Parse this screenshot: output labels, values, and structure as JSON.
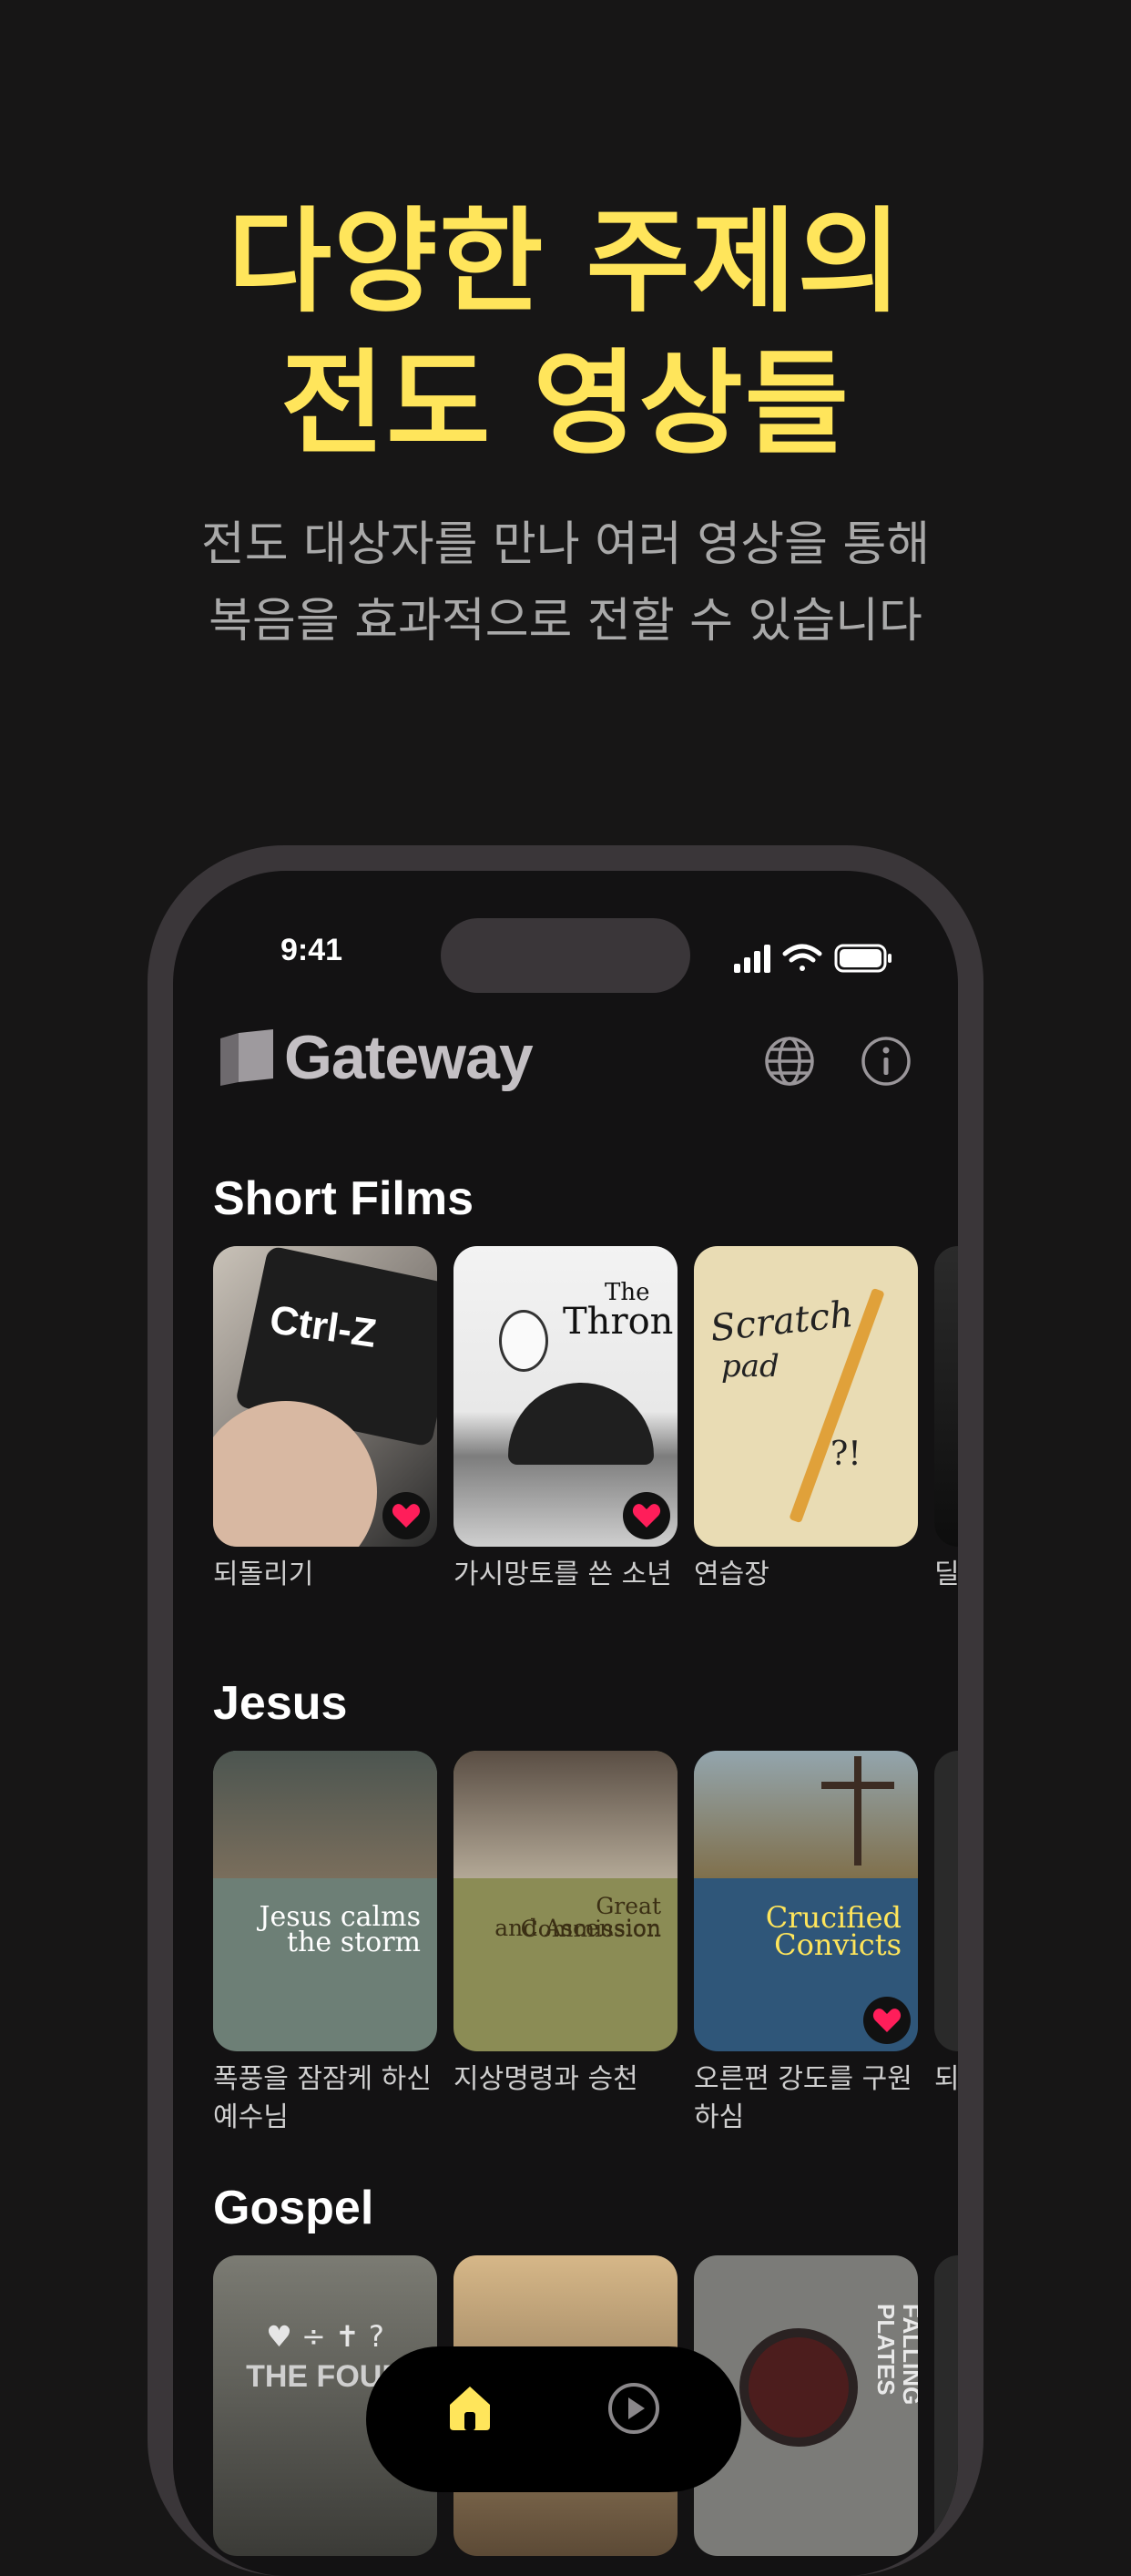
{
  "hero": {
    "title_line1": "다양한 주제의",
    "title_line2": "전도 영상들",
    "subtitle_line1": "전도 대상자를 만나 여러 영상을 통해",
    "subtitle_line2": "복음을 효과적으로 전할 수 있습니다"
  },
  "status": {
    "time": "9:41"
  },
  "app": {
    "name": "Gateway"
  },
  "sections": [
    {
      "title": "Short Films",
      "items": [
        {
          "caption": "되돌리기",
          "thumb_text": "Ctrl-Z",
          "favorite": true
        },
        {
          "caption": "가시망토를 쓴 소년",
          "thumb_text_1": "The",
          "thumb_text_2": "Thron",
          "favorite": true
        },
        {
          "caption": "연습장",
          "thumb_text_1": "Scratch",
          "thumb_text_2": "pad",
          "thumb_text_3": "?!",
          "favorite": false
        },
        {
          "caption": "딜",
          "favorite": false
        }
      ]
    },
    {
      "title": "Jesus",
      "items": [
        {
          "caption": "폭풍을 잠잠케 하신 예수님",
          "thumb_text_1": "Jesus calms",
          "thumb_text_2": "the storm",
          "favorite": false
        },
        {
          "caption": "지상명령과 승천",
          "thumb_text_1": "Great Commission",
          "thumb_text_2": "and Ascension",
          "favorite": false
        },
        {
          "caption": "오른편 강도를 구원하심",
          "thumb_text_1": "Crucified",
          "thumb_text_2": "Convicts",
          "favorite": true
        },
        {
          "caption": "되",
          "favorite": false
        }
      ]
    },
    {
      "title": "Gospel",
      "items": [
        {
          "thumb_text": "THE FOUR",
          "thumb_symbols": "♥ ÷ ✝ ?"
        },
        {},
        {
          "thumb_text": "FALLING PLATES"
        },
        {}
      ]
    }
  ],
  "colors": {
    "accent": "#FFE55B",
    "heart": "#FF1E5A",
    "background": "#171616"
  },
  "icons": [
    "globe-icon",
    "info-icon",
    "heart-icon",
    "home-icon",
    "play-icon"
  ]
}
